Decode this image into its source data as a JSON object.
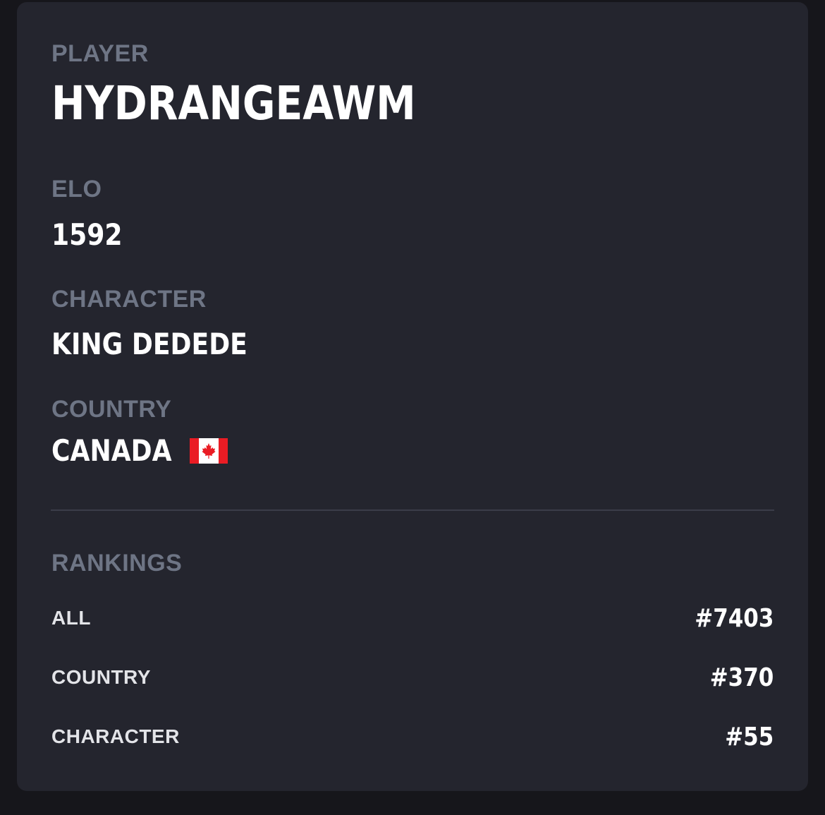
{
  "player": {
    "label": "PLAYER",
    "name": "HYDRANGEAWM"
  },
  "elo": {
    "label": "ELO",
    "value": "1592"
  },
  "character": {
    "label": "CHARACTER",
    "value": "KING DEDEDE"
  },
  "country": {
    "label": "COUNTRY",
    "value": "CANADA",
    "flag_icon": "canada-flag-icon"
  },
  "rankings": {
    "label": "RANKINGS",
    "rows": [
      {
        "label": "ALL",
        "value": "#7403"
      },
      {
        "label": "COUNTRY",
        "value": "#370"
      },
      {
        "label": "CHARACTER",
        "value": "#55"
      }
    ]
  },
  "colors": {
    "page_background": "#16161b",
    "card_background": "#24252e",
    "label_gray": "#6e7585",
    "value_white": "#ffffff",
    "flag_red": "#ea1c24",
    "divider": "#3b3d49"
  }
}
